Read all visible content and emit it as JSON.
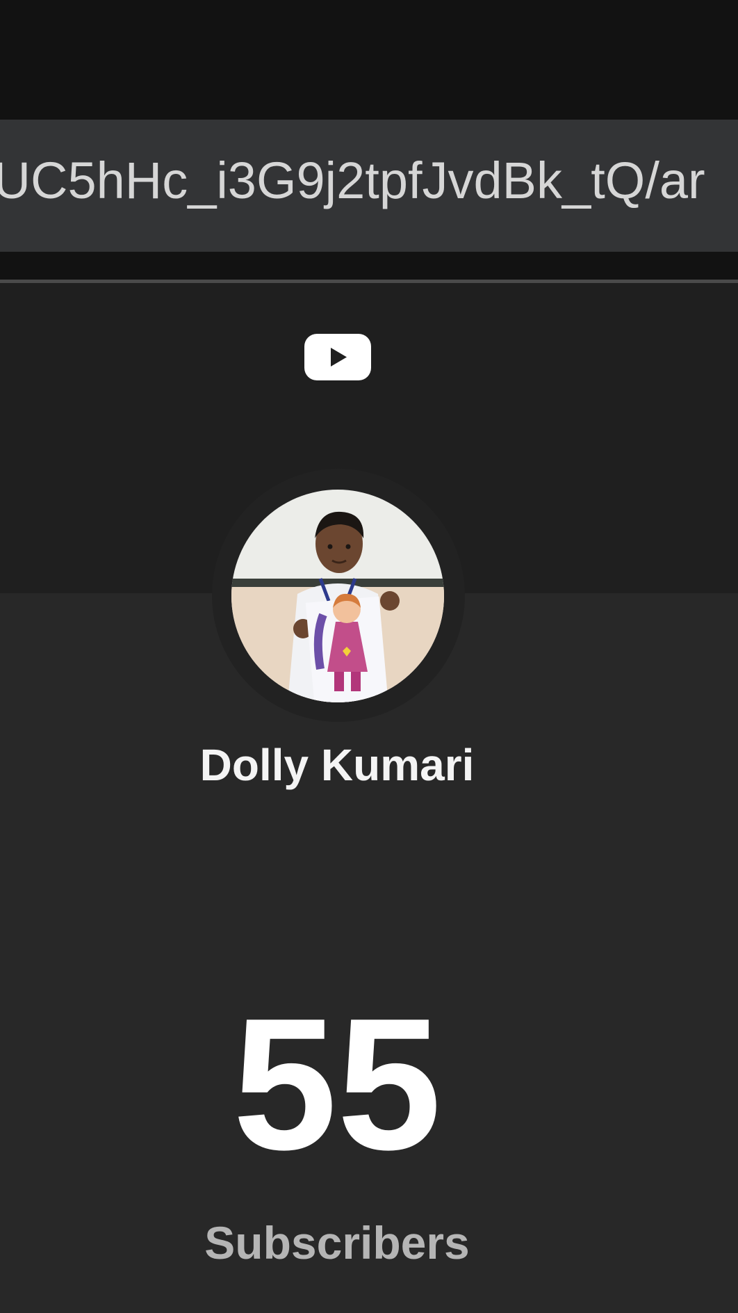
{
  "address_bar": {
    "url_text": "/UC5hHc_i3G9j2tpfJvdBk_tQ/ar"
  },
  "header": {
    "logo_icon": "youtube-play-icon"
  },
  "channel": {
    "avatar_icon": "channel-avatar-photo",
    "name": "Dolly Kumari",
    "subscriber_count": "55",
    "subscriber_label": "Subscribers"
  },
  "colors": {
    "background": "#282828",
    "top_bar": "#121212",
    "url_bar": "#333436",
    "banner": "#1f1f1f",
    "text_primary": "#ffffff",
    "text_secondary": "#b5b5b5"
  }
}
